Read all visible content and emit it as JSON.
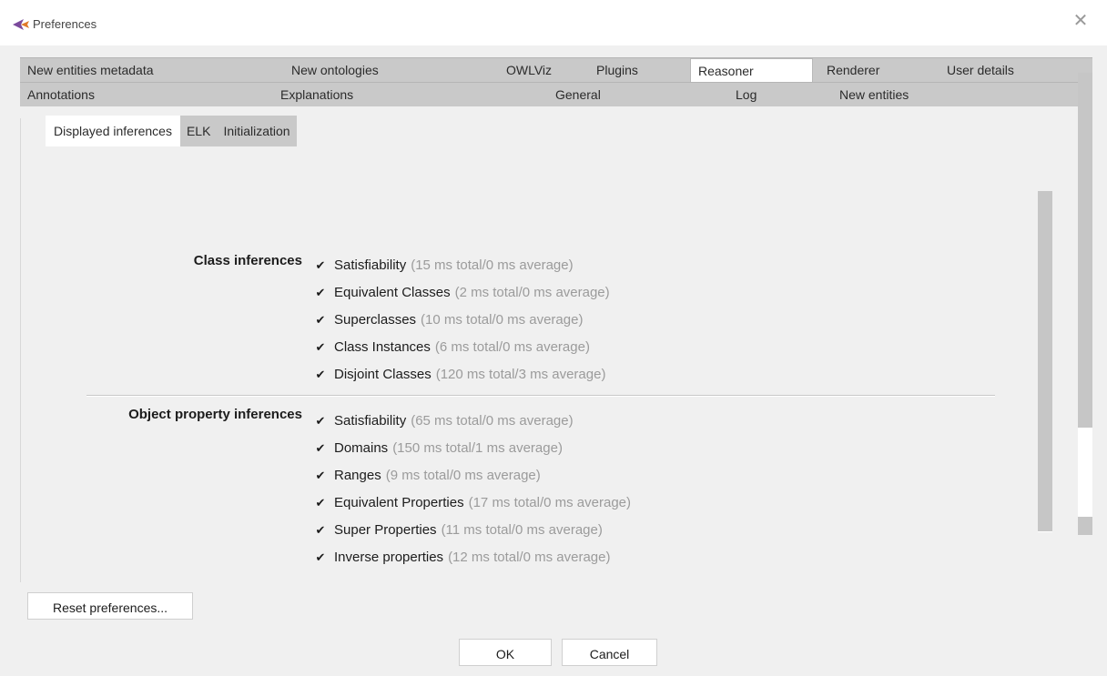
{
  "window": {
    "title": "Preferences",
    "close_icon": "close-icon"
  },
  "tabs": {
    "row1": [
      "New entities metadata",
      "New ontologies",
      "OWLViz",
      "Plugins",
      "Reasoner",
      "Renderer",
      "User details"
    ],
    "row2": [
      "Annotations",
      "Explanations",
      "General",
      "Log",
      "New entities"
    ],
    "selected": "Reasoner"
  },
  "subtabs": {
    "items": [
      "Displayed inferences",
      "ELK",
      "Initialization"
    ],
    "selected": "Displayed inferences"
  },
  "class_inferences": {
    "label": "Class inferences",
    "items": [
      {
        "name": "Satisfiability",
        "stat": "(15 ms total/0 ms average)",
        "checked": true
      },
      {
        "name": "Equivalent Classes",
        "stat": "(2 ms total/0 ms average)",
        "checked": true
      },
      {
        "name": "Superclasses",
        "stat": "(10 ms total/0 ms average)",
        "checked": true
      },
      {
        "name": "Class Instances",
        "stat": "(6 ms total/0 ms average)",
        "checked": true
      },
      {
        "name": "Disjoint Classes",
        "stat": "(120 ms total/3 ms average)",
        "checked": true
      }
    ]
  },
  "object_property_inferences": {
    "label": "Object property inferences",
    "items": [
      {
        "name": "Satisfiability",
        "stat": "(65 ms total/0 ms average)",
        "checked": true
      },
      {
        "name": "Domains",
        "stat": "(150 ms total/1 ms average)",
        "checked": true
      },
      {
        "name": "Ranges",
        "stat": "(9 ms total/0 ms average)",
        "checked": true
      },
      {
        "name": "Equivalent Properties",
        "stat": "(17 ms total/0 ms average)",
        "checked": true
      },
      {
        "name": "Super Properties",
        "stat": "(11 ms total/0 ms average)",
        "checked": true
      },
      {
        "name": "Inverse properties",
        "stat": "(12 ms total/0 ms average)",
        "checked": true
      }
    ]
  },
  "buttons": {
    "reset": "Reset preferences...",
    "ok": "OK",
    "cancel": "Cancel"
  }
}
